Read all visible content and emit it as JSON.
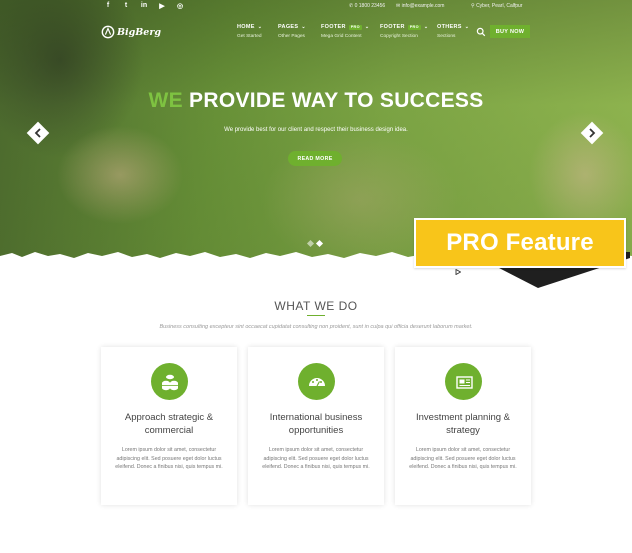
{
  "topbar": {
    "social": [
      "f",
      "t",
      "in",
      "▶",
      "◎"
    ],
    "phone": "0 1800 23456",
    "email": "info@example.com",
    "address": "Cyber, Pearl, Calfpur"
  },
  "brand": {
    "logo_text": "BigBerg"
  },
  "nav": {
    "items": [
      {
        "label": "HOME",
        "sub": "Get Started",
        "badge": ""
      },
      {
        "label": "PAGES",
        "sub": "Other Pages",
        "badge": ""
      },
      {
        "label": "FOOTER",
        "sub": "Mega Grid Content",
        "badge": "PRO"
      },
      {
        "label": "FOOTER",
        "sub": "Copyright Section",
        "badge": "PRO"
      },
      {
        "label": "OTHERS",
        "sub": "Sections",
        "badge": ""
      }
    ],
    "buy_label": "BUY NOW"
  },
  "hero": {
    "headline_accent": "WE",
    "headline_rest": "PROVIDE WAY TO SUCCESS",
    "subline": "We provide best for our client and respect their business design idea.",
    "cta_label": "READ MORE",
    "slide_count": 2,
    "active_slide": 2
  },
  "pro_banner": {
    "label": "PRO Feature"
  },
  "what_we_do": {
    "title": "WHAT WE DO",
    "description": "Business consulting excepteur sint occaecat cupidatat consulting non proident, sunt in culpa qui officia deserunt laborum market.",
    "cards": [
      {
        "icon": "coins-icon",
        "title": "Approach strategic & commercial",
        "text": "Lorem ipsum dolor sit amet, consectetur adipiscing elit. Sed posuere eget dolor luctus eleifend. Donec a finibus nisi, quis tempus mi."
      },
      {
        "icon": "gauge-icon",
        "title": "International business opportunities",
        "text": "Lorem ipsum dolor sit amet, consectetur adipiscing elit. Sed posuere eget dolor luctus eleifend. Donec a finibus nisi, quis tempus mi."
      },
      {
        "icon": "newspaper-icon",
        "title": "Investment planning & strategy",
        "text": "Lorem ipsum dolor sit amet, consectetur adipiscing elit. Sed posuere eget dolor luctus eleifend. Donec a finibus nisi, quis tempus mi."
      }
    ]
  },
  "colors": {
    "accent": "#6fb02e",
    "headline_accent": "#7ec241",
    "pro_banner": "#f8c51a"
  }
}
